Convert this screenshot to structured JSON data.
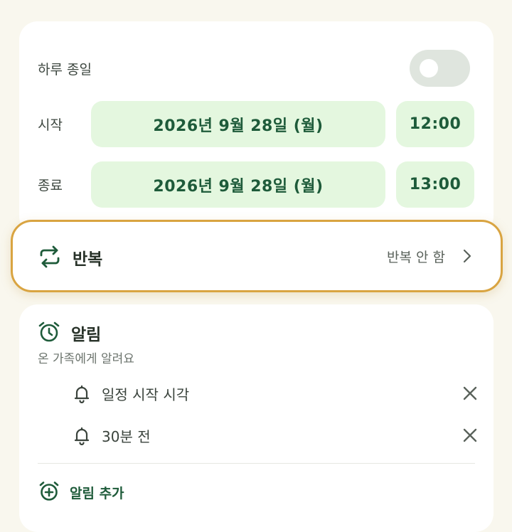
{
  "all_day": {
    "label": "하루 종일",
    "enabled": false
  },
  "start": {
    "label": "시작",
    "date": "2026년 9월 28일 (월)",
    "time": "12:00"
  },
  "end": {
    "label": "종료",
    "date": "2026년 9월 28일 (월)",
    "time": "13:00"
  },
  "repeat": {
    "title": "반복",
    "value": "반복 안 함",
    "icon": "repeat-icon"
  },
  "alarm": {
    "title": "알림",
    "subtitle": "온 가족에게 알려요",
    "items": [
      {
        "label": "일정 시작 시각"
      },
      {
        "label": "30분 전"
      }
    ],
    "add_label": "알림 추가"
  },
  "colors": {
    "accent": "#1e5b3a",
    "pill_bg": "#e4f7df",
    "highlight_border": "#d9a441",
    "background": "#f9f7ee"
  }
}
